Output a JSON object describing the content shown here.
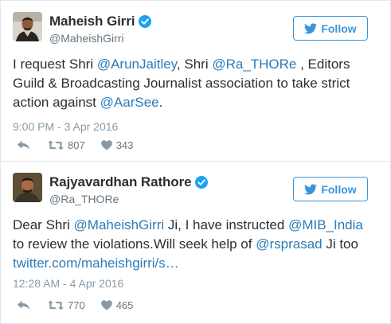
{
  "tweets": [
    {
      "display_name": "Maheish Girri",
      "handle": "@MaheishGirri",
      "follow_label": "Follow",
      "text": {
        "t1": "I request Shri ",
        "m1": "@ArunJaitley",
        "t2": ", Shri ",
        "m2": "@Ra_THORe",
        "t3": " , Editors Guild & Broadcasting Journalist association to take strict action against ",
        "m3": "@AarSee",
        "t4": "."
      },
      "timestamp": "9:00 PM - 3 Apr 2016",
      "retweets": "807",
      "likes": "343"
    },
    {
      "display_name": "Rajyavardhan Rathore",
      "handle": "@Ra_THORe",
      "follow_label": "Follow",
      "text": {
        "t1": "Dear Shri ",
        "m1": "@MaheishGirri",
        "t2": " Ji, I have instructed ",
        "m2": "@MIB_India",
        "t3": " to review the violations.Will seek help of ",
        "m3": "@rsprasad",
        "t4": " Ji too ",
        "l1": "twitter.com/maheishgirri/s…"
      },
      "timestamp": "12:28 AM - 4 Apr 2016",
      "retweets": "770",
      "likes": "465"
    }
  ],
  "colors": {
    "link": "#2b7bb9",
    "follow": "#3b94d9",
    "verified": "#1da1f2",
    "muted": "#8899a6"
  },
  "icons": [
    "verified-badge-icon",
    "twitter-bird-icon",
    "reply-icon",
    "retweet-icon",
    "like-icon"
  ]
}
